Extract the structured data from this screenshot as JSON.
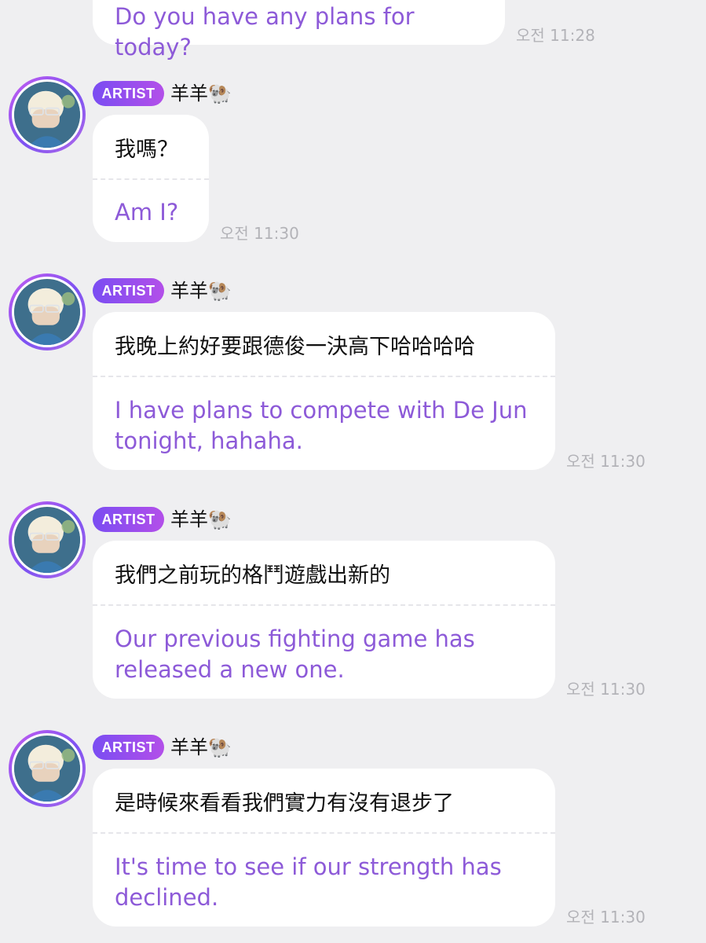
{
  "messages": [
    {
      "id": "m0",
      "from": "fan",
      "translation": "Do you have any plans for today?",
      "time": "오전 11:28"
    },
    {
      "id": "m1",
      "from": "artist",
      "badge": "ARTIST",
      "name": "羊羊🐏",
      "original": "我嗎？",
      "translation": "Am I?",
      "time": "오전 11:30"
    },
    {
      "id": "m2",
      "from": "artist",
      "badge": "ARTIST",
      "name": "羊羊🐏",
      "original": "我晚上約好要跟德俊一決高下哈哈哈哈",
      "translation": "I have plans to compete with De Jun tonight, hahaha.",
      "time": "오전 11:30"
    },
    {
      "id": "m3",
      "from": "artist",
      "badge": "ARTIST",
      "name": "羊羊🐏",
      "original": "我們之前玩的格鬥遊戲出新的",
      "translation": "Our previous fighting game has released a new one.",
      "time": "오전 11:30"
    },
    {
      "id": "m4",
      "from": "artist",
      "badge": "ARTIST",
      "name": "羊羊🐏",
      "original": "是時候來看看我們實力有沒有退步了",
      "translation": "It's time to see if our strength has declined.",
      "time": "오전 11:30"
    }
  ],
  "colors": {
    "background": "#efeff1",
    "bubble": "#ffffff",
    "translation_text": "#8d5ad8",
    "badge_gradient_start": "#7a4df2",
    "badge_gradient_end": "#b34fe9",
    "timestamp_text": "#b3b3b8"
  },
  "icons": {
    "avatar": "artist-avatar-photo"
  }
}
